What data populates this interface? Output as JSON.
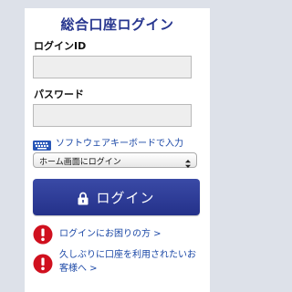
{
  "form": {
    "title": "総合口座ログイン",
    "login_id_label": "ログインID",
    "login_id_value": "",
    "password_label": "パスワード",
    "password_value": ""
  },
  "software_keyboard": {
    "icon": "keyboard-icon",
    "label": "ソフトウェアキーボードで入力"
  },
  "start_page_select": {
    "selected": "ホーム画面にログイン"
  },
  "login_button": {
    "icon": "lock-icon",
    "label": "ログイン"
  },
  "help_links": [
    {
      "icon": "warning-icon",
      "label": "ログインにお困りの方 >"
    },
    {
      "icon": "warning-icon",
      "label_line1": "久しぶりに口座を利用されたいお",
      "label_line2": "客様へ >"
    }
  ],
  "colors": {
    "page_background": "#dde1e9",
    "panel_background": "#ffffff",
    "title": "#27368f",
    "button": "#2d3b96",
    "link": "#1a47a6",
    "warning": "#d0101e",
    "input_background": "#eeeeee"
  }
}
